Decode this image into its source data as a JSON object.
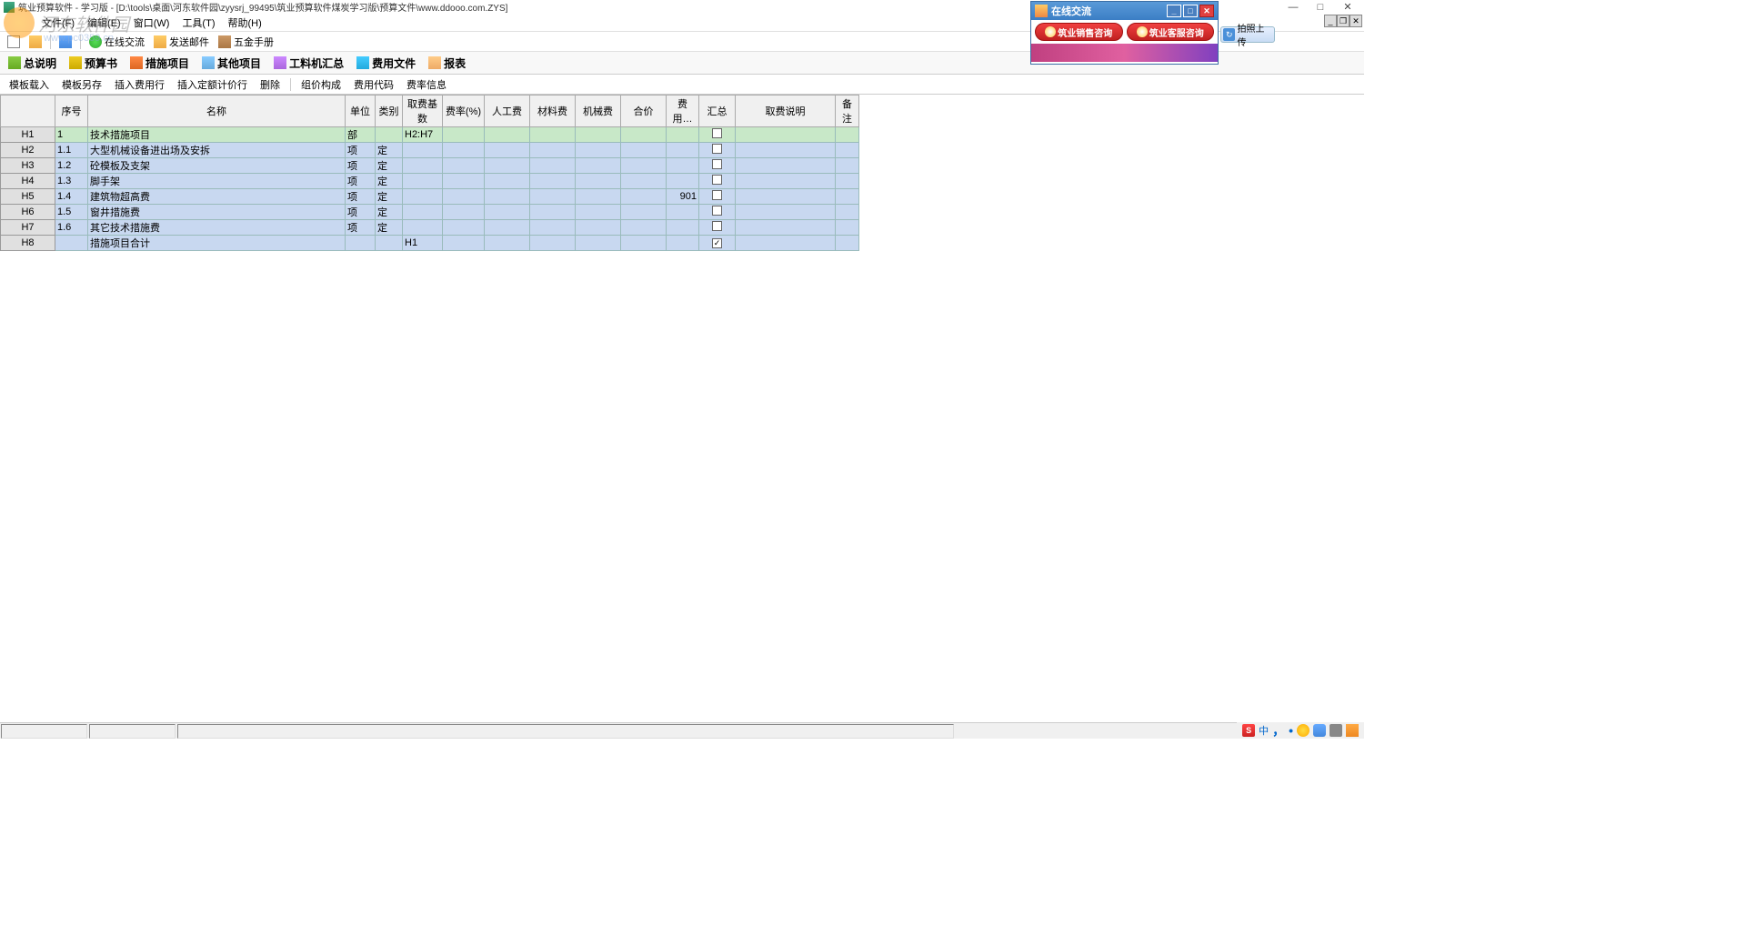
{
  "window": {
    "title": "筑业预算软件 - 学习版 - [D:\\tools\\桌面\\河东软件园\\zyysrj_99495\\筑业预算软件煤炭学习版\\预算文件\\www.ddooo.com.ZYS]"
  },
  "watermark": {
    "text": "河东软件园",
    "url": "www.pc0359.cn"
  },
  "menu": {
    "items": [
      "文件(F)",
      "编辑(E)",
      "窗口(W)",
      "工具(T)",
      "帮助(H)"
    ]
  },
  "toolbar1": {
    "online_chat": "在线交流",
    "send_file": "发送邮件",
    "handbook": "五金手册"
  },
  "tabs": {
    "items": [
      "总说明",
      "预算书",
      "措施项目",
      "其他项目",
      "工料机汇总",
      "费用文件",
      "报表"
    ]
  },
  "subtoolbar": {
    "items": [
      "模板载入",
      "模板另存",
      "插入费用行",
      "插入定额计价行",
      "删除",
      "组价构成",
      "费用代码",
      "费率信息"
    ]
  },
  "table": {
    "headers": [
      "",
      "序号",
      "名称",
      "单位",
      "类别",
      "取费基数",
      "费率(%)",
      "人工费",
      "材料费",
      "机械费",
      "合价",
      "费用…",
      "汇总",
      "取费说明",
      "备注"
    ],
    "rows": [
      {
        "h": "H1",
        "seq": "1",
        "name": "技术措施项目",
        "unit": "部",
        "type": "",
        "base": "H2:H7",
        "rate": "",
        "labor": "",
        "mat": "",
        "mach": "",
        "price": "",
        "use": "",
        "sum": false,
        "desc": "",
        "note": "",
        "cls": "green"
      },
      {
        "h": "H2",
        "seq": "1.1",
        "name": "大型机械设备进出场及安拆",
        "unit": "项",
        "type": "定",
        "base": "",
        "rate": "",
        "labor": "",
        "mat": "",
        "mach": "",
        "price": "",
        "use": "",
        "sum": false,
        "desc": "",
        "note": "",
        "cls": "blue"
      },
      {
        "h": "H3",
        "seq": "1.2",
        "name": "砼模板及支架",
        "unit": "项",
        "type": "定",
        "base": "",
        "rate": "",
        "labor": "",
        "mat": "",
        "mach": "",
        "price": "",
        "use": "",
        "sum": false,
        "desc": "",
        "note": "",
        "cls": "blue"
      },
      {
        "h": "H4",
        "seq": "1.3",
        "name": "脚手架",
        "unit": "项",
        "type": "定",
        "base": "",
        "rate": "",
        "labor": "",
        "mat": "",
        "mach": "",
        "price": "",
        "use": "",
        "sum": false,
        "desc": "",
        "note": "",
        "cls": "blue"
      },
      {
        "h": "H5",
        "seq": "1.4",
        "name": "建筑物超高费",
        "unit": "项",
        "type": "定",
        "base": "",
        "rate": "",
        "labor": "",
        "mat": "",
        "mach": "",
        "price": "",
        "use": "901",
        "sum": false,
        "desc": "",
        "note": "",
        "cls": "blue"
      },
      {
        "h": "H6",
        "seq": "1.5",
        "name": "窗井措施费",
        "unit": "项",
        "type": "定",
        "base": "",
        "rate": "",
        "labor": "",
        "mat": "",
        "mach": "",
        "price": "",
        "use": "",
        "sum": false,
        "desc": "",
        "note": "",
        "cls": "blue"
      },
      {
        "h": "H7",
        "seq": "1.6",
        "name": "其它技术措施费",
        "unit": "项",
        "type": "定",
        "base": "",
        "rate": "",
        "labor": "",
        "mat": "",
        "mach": "",
        "price": "",
        "use": "",
        "sum": false,
        "desc": "",
        "note": "",
        "cls": "blue"
      },
      {
        "h": "H8",
        "seq": "",
        "name": "措施项目合计",
        "unit": "",
        "type": "",
        "base": "H1",
        "rate": "",
        "labor": "",
        "mat": "",
        "mach": "",
        "price": "",
        "use": "",
        "sum": true,
        "desc": "",
        "note": "",
        "cls": "blue"
      }
    ]
  },
  "upload": {
    "label": "拍照上传"
  },
  "chat_popup": {
    "title": "在线交流",
    "btn1": "筑业销售咨询",
    "btn2": "筑业客服咨询"
  },
  "tray": {
    "s": "S",
    "cn": "中"
  }
}
